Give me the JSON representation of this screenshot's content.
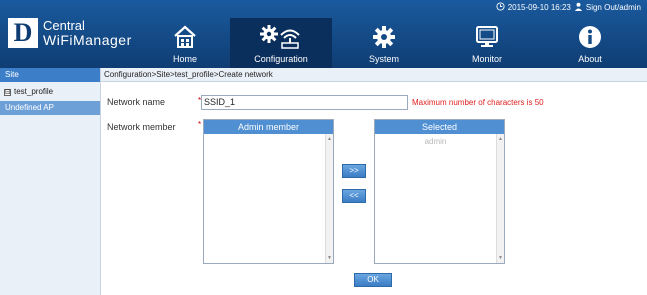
{
  "topbar": {
    "datetime": "2015-09-10 16:23",
    "signout": "Sign Out/admin"
  },
  "logo": {
    "letter": "D",
    "line1": "Central",
    "line2": "WiFiManager"
  },
  "nav": {
    "home": "Home",
    "configuration": "Configuration",
    "system": "System",
    "monitor": "Monitor",
    "about": "About"
  },
  "sidebar": {
    "header": "Site",
    "tree_toggle": "⊟",
    "tree_item": "test_profile",
    "selected_item": "Undefined AP"
  },
  "breadcrumb": "Configuration>Site>test_profile>Create network",
  "form": {
    "network_name_label": "Network name",
    "network_member_label": "Network member",
    "required_mark": "*",
    "network_name_value": "SSID_1",
    "network_name_hint": "Maximum number of characters is 50",
    "admin_member_header": "Admin member",
    "selected_header": "Selected",
    "selected_items": [
      "admin"
    ],
    "move_right_label": ">>",
    "move_left_label": "<<",
    "ok_label": "OK"
  },
  "colors": {
    "header_bg": "#144a86",
    "nav_active_bg": "#0b2f5c",
    "accent_blue": "#4f8fd2",
    "hint_red": "#e02020"
  },
  "icons": {
    "clock": "clock-icon",
    "user": "user-icon",
    "home": "home-icon",
    "configuration": "gear-wifi-icon",
    "system": "gear-icon",
    "monitor": "monitor-icon",
    "about": "info-icon"
  }
}
